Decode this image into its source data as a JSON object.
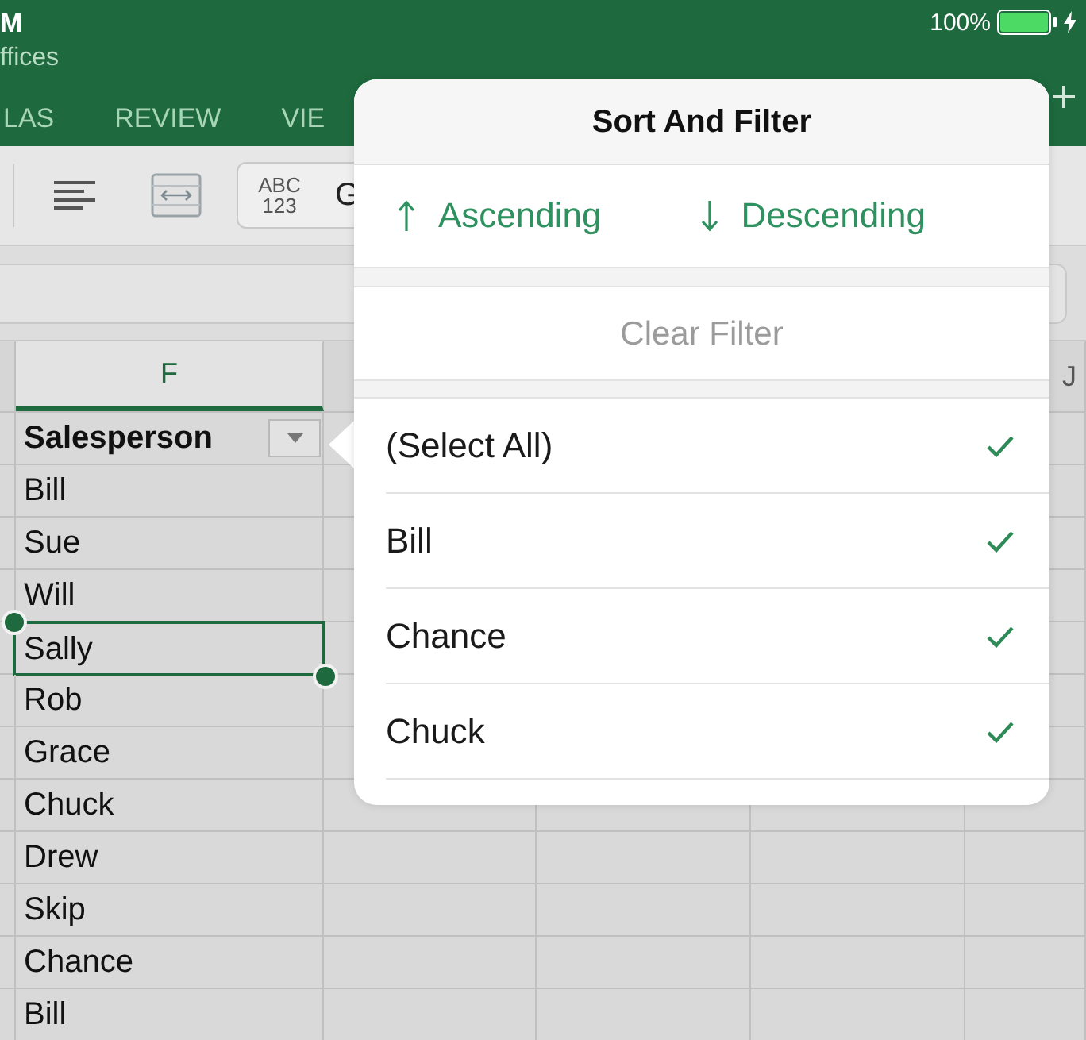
{
  "status_bar": {
    "time": "M",
    "battery": "100%"
  },
  "app_bar": {
    "subtitle": "ffices",
    "tabs": [
      {
        "label": "LAS",
        "selected": false
      },
      {
        "label": "REVIEW",
        "selected": false
      },
      {
        "label": "VIE",
        "selected": false
      }
    ]
  },
  "toolbar": {
    "number_format": {
      "badge": "ABC 123",
      "value": "G"
    }
  },
  "sheet": {
    "columns": [
      {
        "label": "F",
        "selected": true
      },
      {
        "label": "J",
        "selected": false
      }
    ],
    "header": "Salesperson",
    "rows": [
      {
        "value": "Bill",
        "selected": false
      },
      {
        "value": "Sue",
        "selected": false
      },
      {
        "value": "Will",
        "selected": false
      },
      {
        "value": "Sally",
        "selected": true
      },
      {
        "value": "Rob",
        "selected": false
      },
      {
        "value": "Grace",
        "selected": false
      },
      {
        "value": "Chuck",
        "selected": false
      },
      {
        "value": "Drew",
        "selected": false
      },
      {
        "value": "Skip",
        "selected": false
      },
      {
        "value": "Chance",
        "selected": false
      },
      {
        "value": "Bill",
        "selected": false
      }
    ]
  },
  "popover": {
    "title": "Sort And Filter",
    "sort_options": [
      {
        "label": "Ascending",
        "kind": "ascending"
      },
      {
        "label": "Descending",
        "kind": "descending"
      }
    ],
    "clear_filter": {
      "label": "Clear Filter",
      "disabled": true
    },
    "values": [
      {
        "label": "(Select All)",
        "checked": true
      },
      {
        "label": "Bill",
        "checked": true
      },
      {
        "label": "Chance",
        "checked": true
      },
      {
        "label": "Chuck",
        "checked": true
      }
    ]
  }
}
